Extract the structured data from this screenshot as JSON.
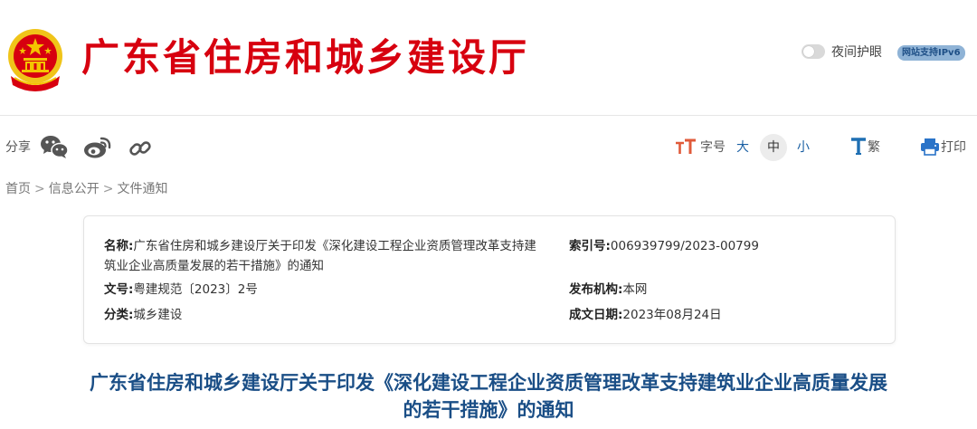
{
  "header": {
    "site_title": "广东省住房和城乡建设厅",
    "night_mode_label": "夜间护眼",
    "ipv6_badge": "网站支持IPv6",
    "colors": {
      "title_red": "#d7000f",
      "emblem_red": "#d7000f",
      "emblem_gold": "#f4c400"
    }
  },
  "toolbar": {
    "share_label": "分享",
    "share_icons": [
      "wechat-icon",
      "weibo-icon",
      "link-icon"
    ],
    "font_size_label": "字号",
    "size_large": "大",
    "size_medium": "中",
    "size_small": "小",
    "selected_size": "中",
    "traditional_label": "繁",
    "print_label": "打印"
  },
  "breadcrumb": {
    "items": [
      "首页",
      "信息公开",
      "文件通知"
    ],
    "separator": ">"
  },
  "info": {
    "name_key": "名称:",
    "name_value": "广东省住房和城乡建设厅关于印发《深化建设工程企业资质管理改革支持建筑业企业高质量发展的若干措施》的通知",
    "index_key": "索引号:",
    "index_value": "006939799/2023-00799",
    "docno_key": "文号:",
    "docno_value": "粤建规范〔2023〕2号",
    "org_key": "发布机构:",
    "org_value": "本网",
    "category_key": "分类:",
    "category_value": "城乡建设",
    "date_key": "成文日期:",
    "date_value": "2023年08月24日"
  },
  "article": {
    "title": "广东省住房和城乡建设厅关于印发《深化建设工程企业资质管理改革支持建筑业企业高质量发展的若干措施》的通知"
  }
}
